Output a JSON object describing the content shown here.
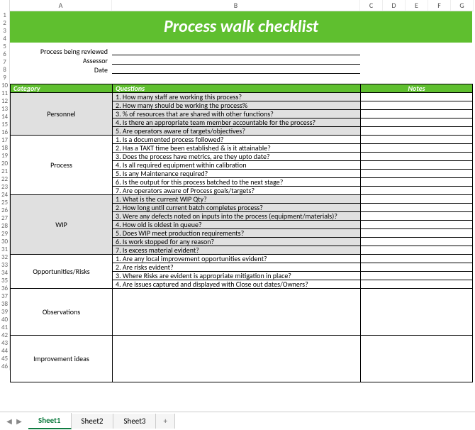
{
  "columns": [
    "A",
    "B",
    "C",
    "D",
    "E",
    "F",
    "G"
  ],
  "rows": [
    "1",
    "2",
    "3",
    "4",
    "5",
    "6",
    "7",
    "8",
    "9",
    "10",
    "11",
    "12",
    "13",
    "14",
    "15",
    "16",
    "17",
    "18",
    "19",
    "20",
    "21",
    "22",
    "23",
    "24",
    "25",
    "26",
    "27",
    "28",
    "29",
    "30",
    "31",
    "32",
    "33",
    "34",
    "35",
    "36",
    "37",
    "38",
    "39",
    "40",
    "41",
    "42",
    "43",
    "44",
    "45",
    "46"
  ],
  "title": "Process walk checklist",
  "meta": {
    "process_label": "Process being reviewed",
    "assessor_label": "Assessor",
    "date_label": "Date"
  },
  "headers": {
    "category": "Category",
    "questions": "Questions",
    "notes": "Notes"
  },
  "sections": [
    {
      "name": "Personnel",
      "shaded": true,
      "questions": [
        "1.  How many staff are working this process?",
        "2.  How many should be working the process%",
        "3. % of resources that are shared with other functions?",
        "4. Is there an appropriate team member accountable for the process?",
        "5. Are operators aware of targets/objectives?"
      ]
    },
    {
      "name": "Process",
      "shaded": false,
      "questions": [
        "1. Is a documented process followed?",
        "2. Has a TAKT time been established & is it attainable?",
        "3. Does the process have metrics, are they upto date?",
        "4. Is all required equipment within calibration",
        "5. Is any Maintenance required?",
        "6. Is the output for this process batched to the next stage?",
        "7. Are operators aware of Process goals/targets?"
      ]
    },
    {
      "name": "WIP",
      "shaded": true,
      "questions": [
        "1.  What is the current WIP Qty?",
        "2. How long until current batch completes process?",
        "3. Were any defects noted on inputs into the process (equipment/materials)?",
        "4. How old is oldest in queue?",
        "5. Does WIP meet production requirements?",
        "6. Is work stopped for any reason?",
        "7. Is excess material evident?"
      ]
    },
    {
      "name": "Opportunities/Risks",
      "shaded": false,
      "questions": [
        "1. Are any local improvement opportunities evident?",
        "2.  Are risks evident?",
        "3. Where Risks are evident is appropriate mitigation in place?",
        "4. Are issues captured and displayed with Close out dates/Owners?"
      ]
    },
    {
      "name": "Observations",
      "shaded": false,
      "questions": [
        ""
      ],
      "tall": 6
    },
    {
      "name": "Improvement ideas",
      "shaded": false,
      "questions": [
        ""
      ],
      "tall": 6
    }
  ],
  "tabs": {
    "active": "Sheet1",
    "others": [
      "Sheet2",
      "Sheet3"
    ],
    "add": "+"
  },
  "nav": {
    "prev": "◀",
    "next": "▶"
  }
}
